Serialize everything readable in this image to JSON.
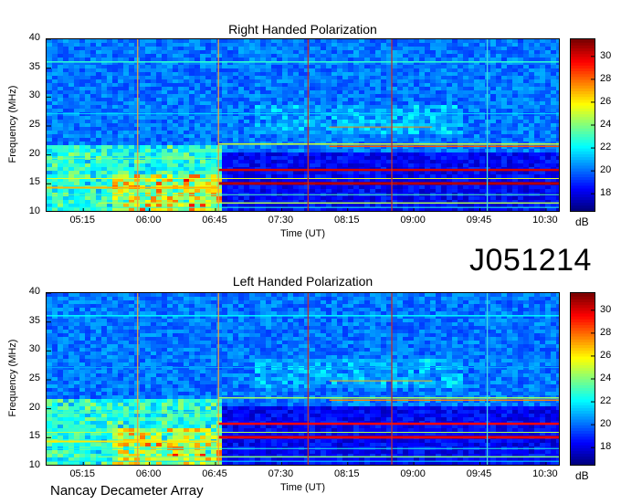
{
  "page": {
    "identifier": "J051214",
    "footer": "Nancay Decameter Array"
  },
  "chart_data": [
    {
      "type": "heatmap",
      "title": "Right Handed Polarization",
      "xlabel": "Time (UT)",
      "ylabel": "Frequency (MHz)",
      "x_ticks": [
        "05:15",
        "06:00",
        "06:45",
        "07:30",
        "08:15",
        "09:00",
        "09:45",
        "10:30"
      ],
      "x_range": [
        "04:50",
        "10:40"
      ],
      "y_ticks": [
        10,
        15,
        20,
        25,
        30,
        35,
        40
      ],
      "ylim": [
        10,
        40
      ],
      "colorbar": {
        "label": "dB",
        "ticks": [
          18,
          20,
          22,
          24,
          26,
          28,
          30
        ],
        "range": [
          16.5,
          31.5
        ]
      },
      "vertical_markers": [
        {
          "time": "05:52",
          "color": "#e8a040"
        },
        {
          "time": "06:47",
          "color": "#e8a040"
        },
        {
          "time": "07:48",
          "color": "#c03030"
        },
        {
          "time": "08:45",
          "color": "#c03030"
        },
        {
          "time": "09:50",
          "color": "#40d8e0"
        }
      ]
    },
    {
      "type": "heatmap",
      "title": "Left Handed Polarization",
      "xlabel": "Time (UT)",
      "ylabel": "Frequency (MHz)",
      "x_ticks": [
        "05:15",
        "06:00",
        "06:45",
        "07:30",
        "08:15",
        "09:00",
        "09:45",
        "10:30"
      ],
      "x_range": [
        "04:50",
        "10:40"
      ],
      "y_ticks": [
        10,
        15,
        20,
        25,
        30,
        35,
        40
      ],
      "ylim": [
        10,
        40
      ],
      "colorbar": {
        "label": "dB",
        "ticks": [
          18,
          20,
          22,
          24,
          26,
          28,
          30
        ],
        "range": [
          16.5,
          31.5
        ]
      },
      "vertical_markers": [
        {
          "time": "05:52",
          "color": "#e8a040"
        },
        {
          "time": "06:47",
          "color": "#e8a040"
        },
        {
          "time": "07:48",
          "color": "#c03030"
        },
        {
          "time": "08:45",
          "color": "#c03030"
        },
        {
          "time": "09:50",
          "color": "#40d8e0"
        }
      ]
    }
  ]
}
